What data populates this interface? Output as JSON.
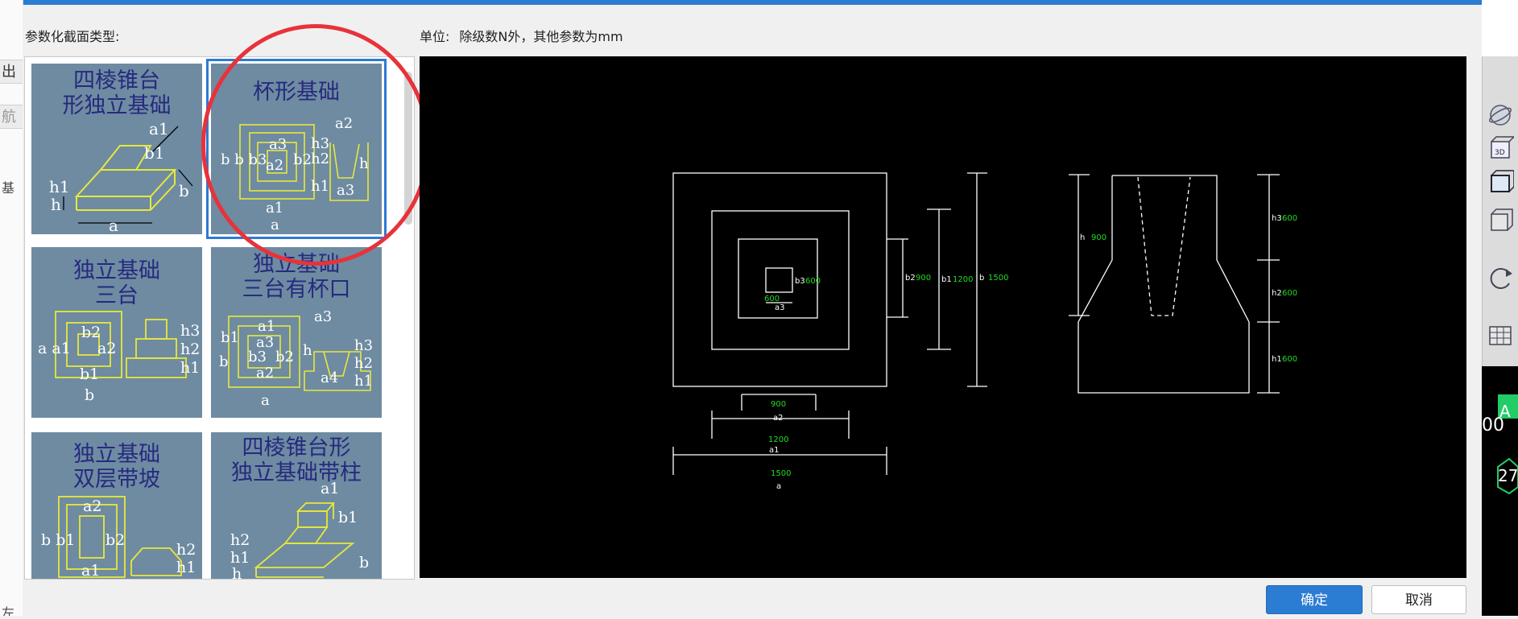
{
  "left_strip": {
    "chars": [
      "出",
      "航",
      "基",
      "左"
    ]
  },
  "dialog": {
    "section_label": "参数化截面类型:",
    "unit_label": "单位:",
    "unit_text": "除级数N外，其他参数为mm",
    "thumbnails": [
      {
        "title_line1": "四棱锥台",
        "title_line2": "形独立基础",
        "selected": false
      },
      {
        "title_line1": "杯形基础",
        "title_line2": "",
        "selected": true
      },
      {
        "title_line1": "独立基础",
        "title_line2": "三台",
        "selected": false
      },
      {
        "title_line1": "独立基础",
        "title_line2": "三台有杯口",
        "selected": false
      },
      {
        "title_line1": "独立基础",
        "title_line2": "双层带坡",
        "selected": false
      },
      {
        "title_line1": "四棱锥台形",
        "title_line2": "独立基础带柱",
        "selected": false
      }
    ],
    "thumb_labels": {
      "a": "a",
      "b": "b",
      "h": "h",
      "a1": "a1",
      "a2": "a2",
      "a3": "a3",
      "a4": "a4",
      "b1": "b1",
      "b2": "b2",
      "b3": "b3",
      "h1": "h1",
      "h2": "h2",
      "h3": "h3",
      "bb": "b b",
      "bb1": "b b1",
      "bbb3": "b b b3",
      "aa1": "a a1",
      "bb1a1": "b b1"
    },
    "drawing": {
      "dims": {
        "a": "1500",
        "a1": "1200",
        "a2": "900",
        "a3": "600",
        "b": "1500",
        "b1": "1200",
        "b2": "900",
        "b3": "600",
        "h": "900",
        "h1": "600",
        "h2": "600",
        "h3": "600"
      },
      "labels": {
        "a": "a",
        "a1": "a1",
        "a2": "a2",
        "a3": "a3",
        "b": "b",
        "b1": "b1",
        "b2": "b2",
        "b3": "b3",
        "h": "h",
        "h1": "h1",
        "h2": "h2",
        "h3": "h3"
      }
    },
    "buttons": {
      "ok": "确定",
      "cancel": "取消"
    }
  },
  "right_panel": {
    "icons": [
      "globe-icon",
      "3d-view-icon",
      "cube-front-icon",
      "cube-iso-icon",
      "rotate-icon",
      "layer-grid-icon"
    ],
    "label_3d": "3D",
    "viewport_text_1": "A",
    "viewport_text_2": "00",
    "viewport_text_3": "27"
  },
  "colors": {
    "accent": "#2b7cd3",
    "thumb_bg": "#6e8ba2",
    "thumb_title": "#262a7e",
    "thumb_lines": "#e8e83a",
    "drawing_lines": "#ffffff",
    "dim_values": "#22dd22",
    "annotation_circle": "#e8323a"
  }
}
